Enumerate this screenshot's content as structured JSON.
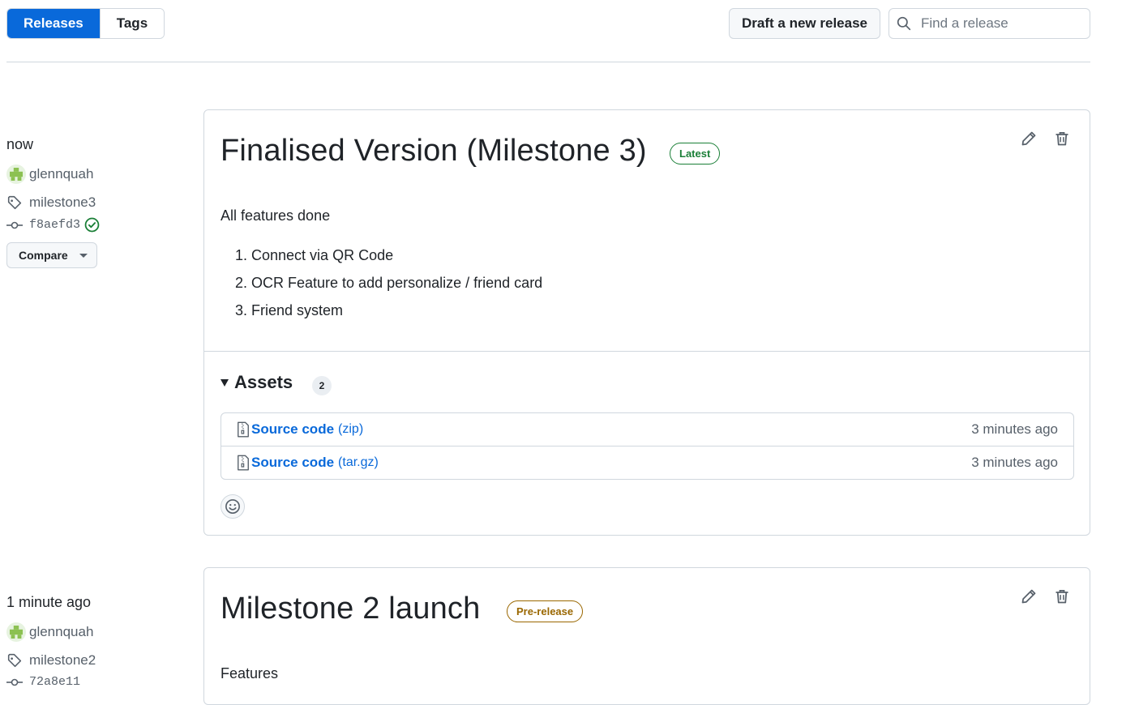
{
  "nav": {
    "tabs": [
      {
        "label": "Releases",
        "active": true
      },
      {
        "label": "Tags",
        "active": false
      }
    ],
    "draft_label": "Draft a new release",
    "search_placeholder": "Find a release"
  },
  "releases": [
    {
      "time": "now",
      "author": "glennquah",
      "tag": "milestone3",
      "commit": "f8aefd3",
      "verified": true,
      "compare_label": "Compare",
      "title": "Finalised Version (Milestone 3)",
      "badge": "Latest",
      "description": "All features done",
      "features": [
        "1. Connect via QR Code",
        "2. OCR Feature to add personalize / friend card",
        "3. Friend system"
      ],
      "assets_label": "Assets",
      "assets_count": "2",
      "assets": [
        {
          "name": "Source code",
          "format": "(zip)",
          "time": "3 minutes ago"
        },
        {
          "name": "Source code",
          "format": "(tar.gz)",
          "time": "3 minutes ago"
        }
      ]
    },
    {
      "time": "1 minute ago",
      "author": "glennquah",
      "tag": "milestone2",
      "commit": "72a8e11",
      "title": "Milestone 2 launch",
      "badge": "Pre-release",
      "description": "Features"
    }
  ],
  "colors": {
    "accent": "#0969da",
    "latest": "#1a7f37",
    "prerelease": "#9a6700"
  }
}
